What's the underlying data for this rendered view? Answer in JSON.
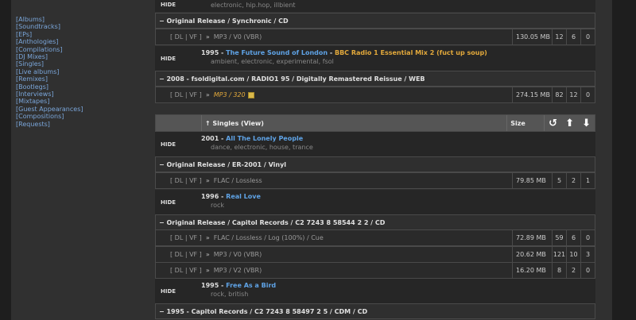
{
  "sidebar": {
    "links": [
      "[Albums]",
      "[Soundtracks]",
      "[EPs]",
      "[Anthologies]",
      "[Compilations]",
      "[DJ Mixes]",
      "[Singles]",
      "[Live albums]",
      "[Remixes]",
      "[Bootlegs]",
      "[Interviews]",
      "[Mixtapes]",
      "[Guest Appearances]",
      "[Compositions]",
      "[Requests]"
    ]
  },
  "top_partial": {
    "hide": "HIDE",
    "tags": "electronic, hip.hop, illbient"
  },
  "edition_1": {
    "label": "− Original Release / Synchronic / CD"
  },
  "torrent_1": {
    "links": "[ DL | VF ]",
    "arrow": "»",
    "format": "MP3 / V0 (VBR)",
    "size": "130.05 MB",
    "snatches": "12",
    "seeders": "6",
    "leechers": "0"
  },
  "group_1": {
    "hide": "HIDE",
    "year": "1995 - ",
    "title": "The Future Sound of London",
    "dash": " - ",
    "alt": "BBC Radio 1 Essential Mix 2 (fuct up soup)",
    "tags": "ambient, electronic, experimental, fsol"
  },
  "edition_2": {
    "label": "− 2008 - fsoldigital.com / RADIO1 95 / Digitally Remastered Reissue / WEB"
  },
  "torrent_2": {
    "links": "[ DL | VF ]",
    "arrow": "»",
    "format": "MP3 / 320",
    "size": "274.15 MB",
    "snatches": "82",
    "seeders": "12",
    "leechers": "0"
  },
  "singles_header": {
    "title": "↑ Singles (View)",
    "size": "Size",
    "icons": [
      "↺",
      "⬆",
      "⬇"
    ]
  },
  "group_2": {
    "hide": "HIDE",
    "year": "2001 - ",
    "title": "All The Lonely People",
    "tags": "dance, electronic, house, trance"
  },
  "edition_3": {
    "label": "− Original Release / ER-2001 / Vinyl"
  },
  "torrent_3": {
    "links": "[ DL | VF ]",
    "arrow": "»",
    "format": "FLAC / Lossless",
    "size": "79.85 MB",
    "snatches": "5",
    "seeders": "2",
    "leechers": "1"
  },
  "group_3": {
    "hide": "HIDE",
    "year": "1996 - ",
    "title": "Real Love",
    "tags": "rock"
  },
  "edition_4": {
    "label": "− Original Release / Capitol Records / C2 7243 8 58544 2 2 / CD"
  },
  "torrent_4": {
    "links": "[ DL | VF ]",
    "arrow": "»",
    "format": "FLAC / Lossless / Log (100%) / Cue",
    "size": "72.89 MB",
    "snatches": "59",
    "seeders": "6",
    "leechers": "0"
  },
  "torrent_5": {
    "links": "[ DL | VF ]",
    "arrow": "»",
    "format": "MP3 / V0 (VBR)",
    "size": "20.62 MB",
    "snatches": "121",
    "seeders": "10",
    "leechers": "3"
  },
  "torrent_6": {
    "links": "[ DL | VF ]",
    "arrow": "»",
    "format": "MP3 / V2 (VBR)",
    "size": "16.20 MB",
    "snatches": "8",
    "seeders": "2",
    "leechers": "0"
  },
  "group_4": {
    "hide": "HIDE",
    "year": "1995 - ",
    "title": "Free As a Bird",
    "tags": "rock, british"
  },
  "edition_5": {
    "label": "− 1995 - Capitol Records / C2 7243 8 58497 2 5 / CDM / CD"
  }
}
